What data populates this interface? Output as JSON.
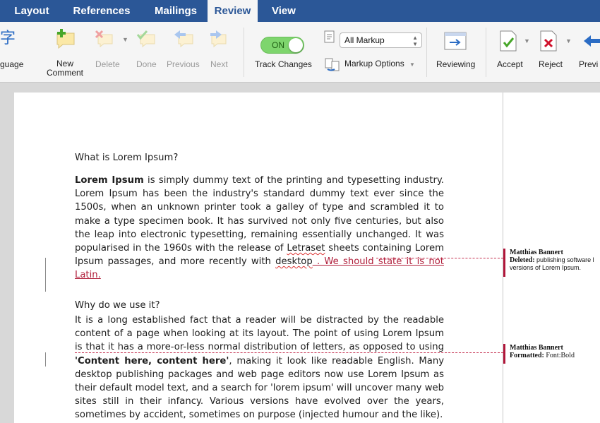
{
  "tabs": [
    "Layout",
    "References",
    "Mailings",
    "Review",
    "View"
  ],
  "active_tab": "Review",
  "ribbon": {
    "language_label": "guage",
    "new_comment_line1": "New",
    "new_comment_line2": "Comment",
    "delete_label": "Delete",
    "done_label": "Done",
    "previous_label": "Previous",
    "next_label": "Next",
    "toggle_label": "ON",
    "track_changes_label": "Track Changes",
    "markup_select_value": "All Markup",
    "markup_options_label": "Markup Options",
    "reviewing_label": "Reviewing",
    "accept_label": "Accept",
    "reject_label": "Reject",
    "previous_change_label": "Previ"
  },
  "document": {
    "heading1": "What is Lorem Ipsum?",
    "p1_bold": "Lorem Ipsum",
    "p1_text": " is simply dummy text of the printing and typesetting industry. Lorem Ipsum has been the industry's standard dummy text ever since the 1500s, when an unknown printer took a galley of type and scrambled it to make a type specimen book. It has survived not only five centuries, but also the leap into electronic typesetting, remaining essentially unchanged. It was popularised in the 1960s with the release of ",
    "p1_letraset": "Letraset",
    "p1_text2": " sheets containing Lorem Ipsum passages, and more recently with ",
    "p1_desktop": "desktop",
    "p1_inserted": " . We should state it is not Latin.",
    "heading2": "Why do we use it?",
    "p2_text": "It is a long established fact that a reader will be distracted by the readable content of a page when looking at its layout. The point of using Lorem Ipsum is that it has a more-or-less normal distribution of letters, as opposed to using ",
    "p2_bold": "'Content here, content here'",
    "p2_text2": ", making it look like readable English. Many desktop publishing packages and web page editors now use Lorem Ipsum as their default model text, and a search for 'lorem ipsum' will uncover many web sites still in their infancy. Various versions have evolved over the years, sometimes by accident, sometimes on purpose (injected humour and the like)."
  },
  "balloons": [
    {
      "author": "Matthias Bannert",
      "action": "Deleted:",
      "text": " publishing software l",
      "text2": "versions of Lorem Ipsum."
    },
    {
      "author": "Matthias Bannert",
      "action": "Formatted:",
      "text": " Font:Bold"
    }
  ],
  "colors": {
    "tab_bar": "#2b5797",
    "revision": "#b01e3a",
    "toggle_on": "#7ed56d"
  }
}
